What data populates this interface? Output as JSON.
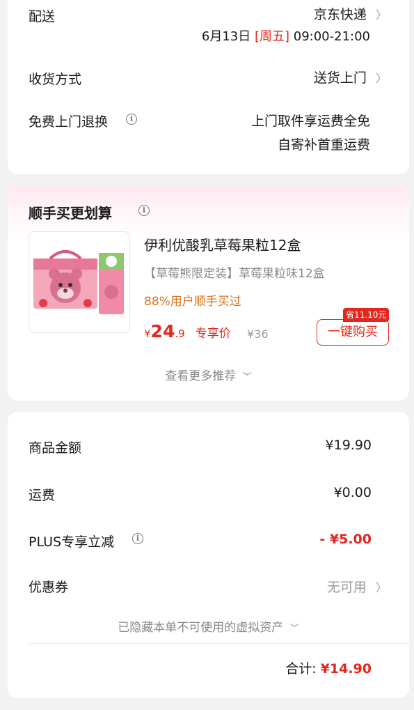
{
  "delivery_card": {
    "delivery_label": "配送",
    "delivery_value": "京东快递",
    "delivery_date": "6月13日",
    "delivery_weekday": "[周五]",
    "delivery_time": "09:00-21:00",
    "receive_label": "收货方式",
    "receive_value": "送货上门",
    "return_label": "免费上门退换",
    "return_line1": "上门取件享运费全免",
    "return_line2": "自寄补首重运费"
  },
  "deal_card": {
    "title": "顺手买更划算",
    "product": {
      "name": "伊利优酸乳草莓果粒12盒",
      "subtitle": "【草莓熊限定装】草莓果粒味12盒",
      "promo": "88%用户顺手买过",
      "currency": "¥",
      "price_int": "24",
      "price_dec": ".9",
      "price_tag": "专享价",
      "original_price": "¥36",
      "save_badge": "省11.10元",
      "buy_button": "一键购买"
    },
    "more_link": "查看更多推荐"
  },
  "summary_card": {
    "rows": [
      {
        "label": "商品金额",
        "value": "¥19.90"
      },
      {
        "label": "运费",
        "value": "¥0.00"
      },
      {
        "label": "PLUS专享立减",
        "value": "- ¥5.00"
      },
      {
        "label": "优惠券",
        "value": "无可用"
      }
    ],
    "hidden_note": "已隐藏本单不可使用的虚拟资产",
    "total_label": "合计:",
    "total_value": "¥14.90"
  },
  "colors": {
    "accent_red": "#e4261c",
    "promo_orange": "#d9741a",
    "muted": "#999999"
  }
}
